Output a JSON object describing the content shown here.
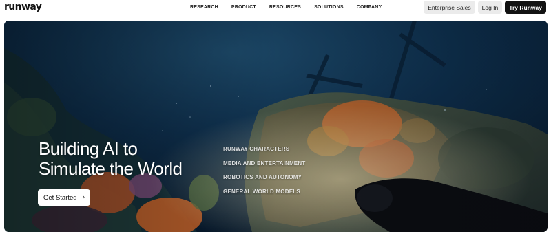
{
  "brand": {
    "logo": "runway"
  },
  "nav": {
    "items": [
      {
        "label": "RESEARCH"
      },
      {
        "label": "PRODUCT"
      },
      {
        "label": "RESOURCES"
      },
      {
        "label": "SOLUTIONS"
      },
      {
        "label": "COMPANY"
      }
    ]
  },
  "header_actions": {
    "enterprise_label": "Enterprise Sales",
    "login_label": "Log In",
    "try_label": "Try Runway"
  },
  "hero": {
    "headline_line1": "Building AI to",
    "headline_line2": "Simulate the World",
    "cta_label": "Get Started",
    "cta_icon": "chevron-right-icon",
    "background_image": "underwater-shipwreck-diver",
    "topics": [
      {
        "label": "RUNWAY CHARACTERS"
      },
      {
        "label": "MEDIA AND ENTERTAINMENT"
      },
      {
        "label": "ROBOTICS AND AUTONOMY"
      },
      {
        "label": "GENERAL WORLD MODELS"
      }
    ]
  },
  "colors": {
    "primary_button": "#121212",
    "secondary_button": "#ebebeb",
    "hero_water": "#0b2a44",
    "reef_orange": "#c8642a"
  }
}
